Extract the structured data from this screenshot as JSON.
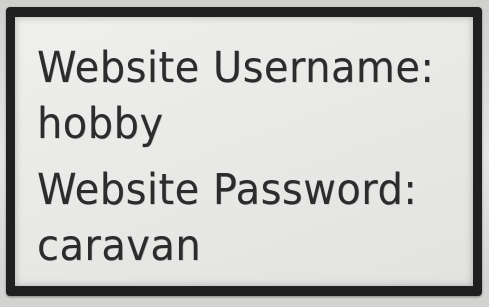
{
  "display": {
    "username_label": "Website Username:",
    "username_value": "hobby",
    "password_label": "Website Password:",
    "password_value": "caravan"
  },
  "colors": {
    "screen_background": "#ebebe9",
    "text": "#2c2c2c",
    "frame": "#202020"
  }
}
